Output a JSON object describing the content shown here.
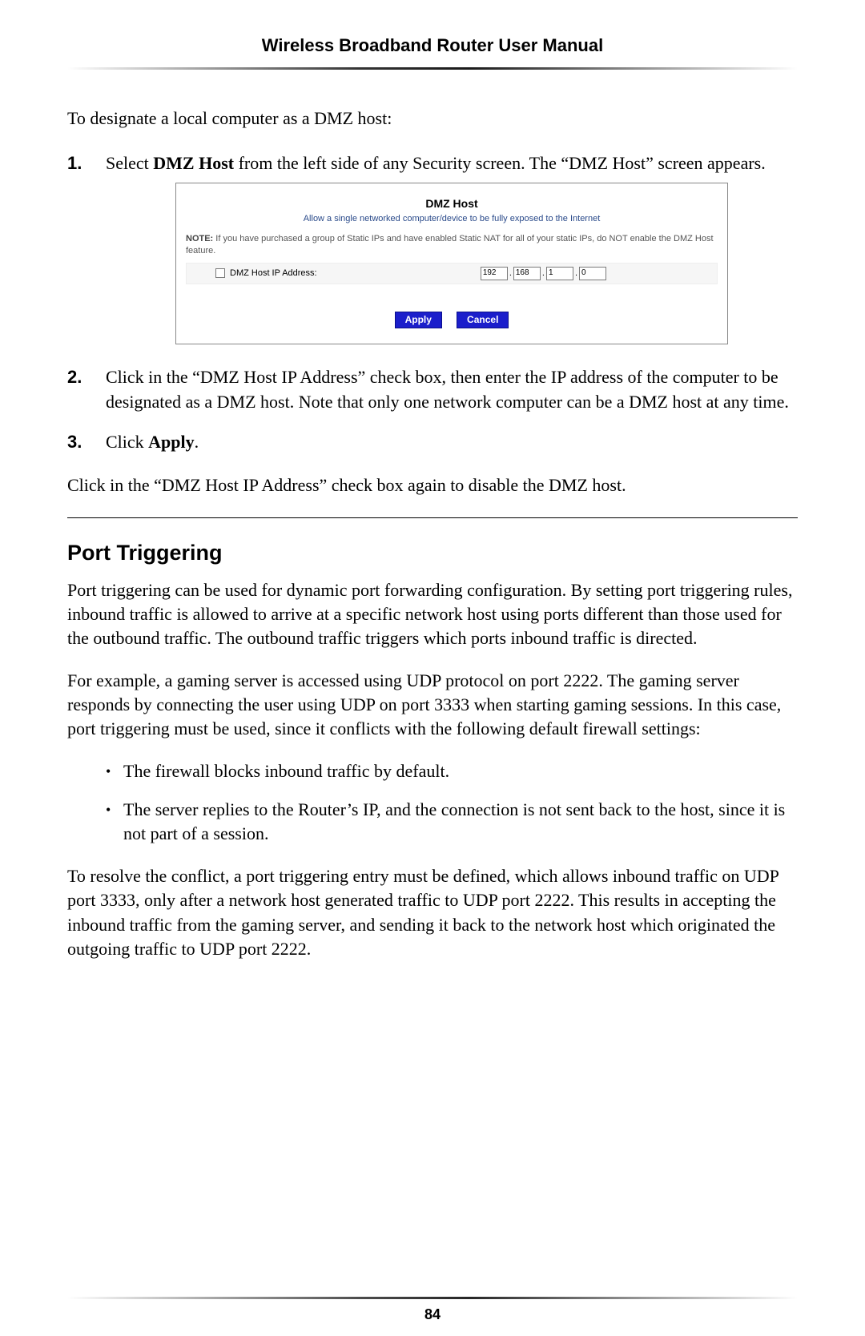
{
  "header": {
    "title": "Wireless Broadband Router User Manual"
  },
  "intro": "To designate a local computer as a DMZ host:",
  "steps": {
    "s1_num": "1.",
    "s1_text_a": "Select ",
    "s1_text_b": "DMZ Host",
    "s1_text_c": " from the left side of any Security screen. The “DMZ Host” screen appears.",
    "s2_num": "2.",
    "s2_text": "Click in the “DMZ Host IP Address” check box, then enter the IP address of the computer to be designated as a DMZ host. Note that only one network computer can be a DMZ host at any time.",
    "s3_num": "3.",
    "s3_text_a": "Click ",
    "s3_text_b": "Apply",
    "s3_text_c": "."
  },
  "screenshot": {
    "title": "DMZ Host",
    "subtitle": "Allow a single networked computer/device to be fully exposed to the Internet",
    "note_prefix": "NOTE:",
    "note_body": " If you have purchased a group of Static IPs and have enabled Static NAT for all of your static IPs, do NOT enable the DMZ Host feature.",
    "ip_label": "DMZ Host IP Address:",
    "octets": [
      "192",
      "168",
      "1",
      "0"
    ],
    "apply": "Apply",
    "cancel": "Cancel"
  },
  "after_disable": "Click in the “DMZ Host IP Address” check box again to disable the DMZ host.",
  "section": {
    "heading": "Port Triggering",
    "p1": "Port triggering can be used for dynamic port forwarding configuration. By setting port triggering rules, inbound traffic is allowed to arrive at a specific network host using ports different than those used for the outbound traffic. The outbound traffic triggers which ports inbound traffic is directed.",
    "p2": "For example, a gaming server is accessed using UDP protocol on port 2222. The gaming server responds by connecting the user using UDP on port 3333 when starting gaming sessions. In this case, port triggering must be used, since it conflicts with the following default firewall settings:",
    "bullets": [
      "The firewall blocks inbound traffic by default.",
      "The server replies to the Router’s IP, and the connection is not sent back to the host, since it is not part of a session."
    ],
    "p3": "To resolve the conflict, a port triggering entry must be defined, which allows inbound traffic on UDP port 3333, only after a network host generated traffic to UDP port 2222. This results in accepting the inbound traffic from the gaming server, and sending it back to the network host which originated the outgoing traffic to UDP port 2222."
  },
  "page_number": "84"
}
